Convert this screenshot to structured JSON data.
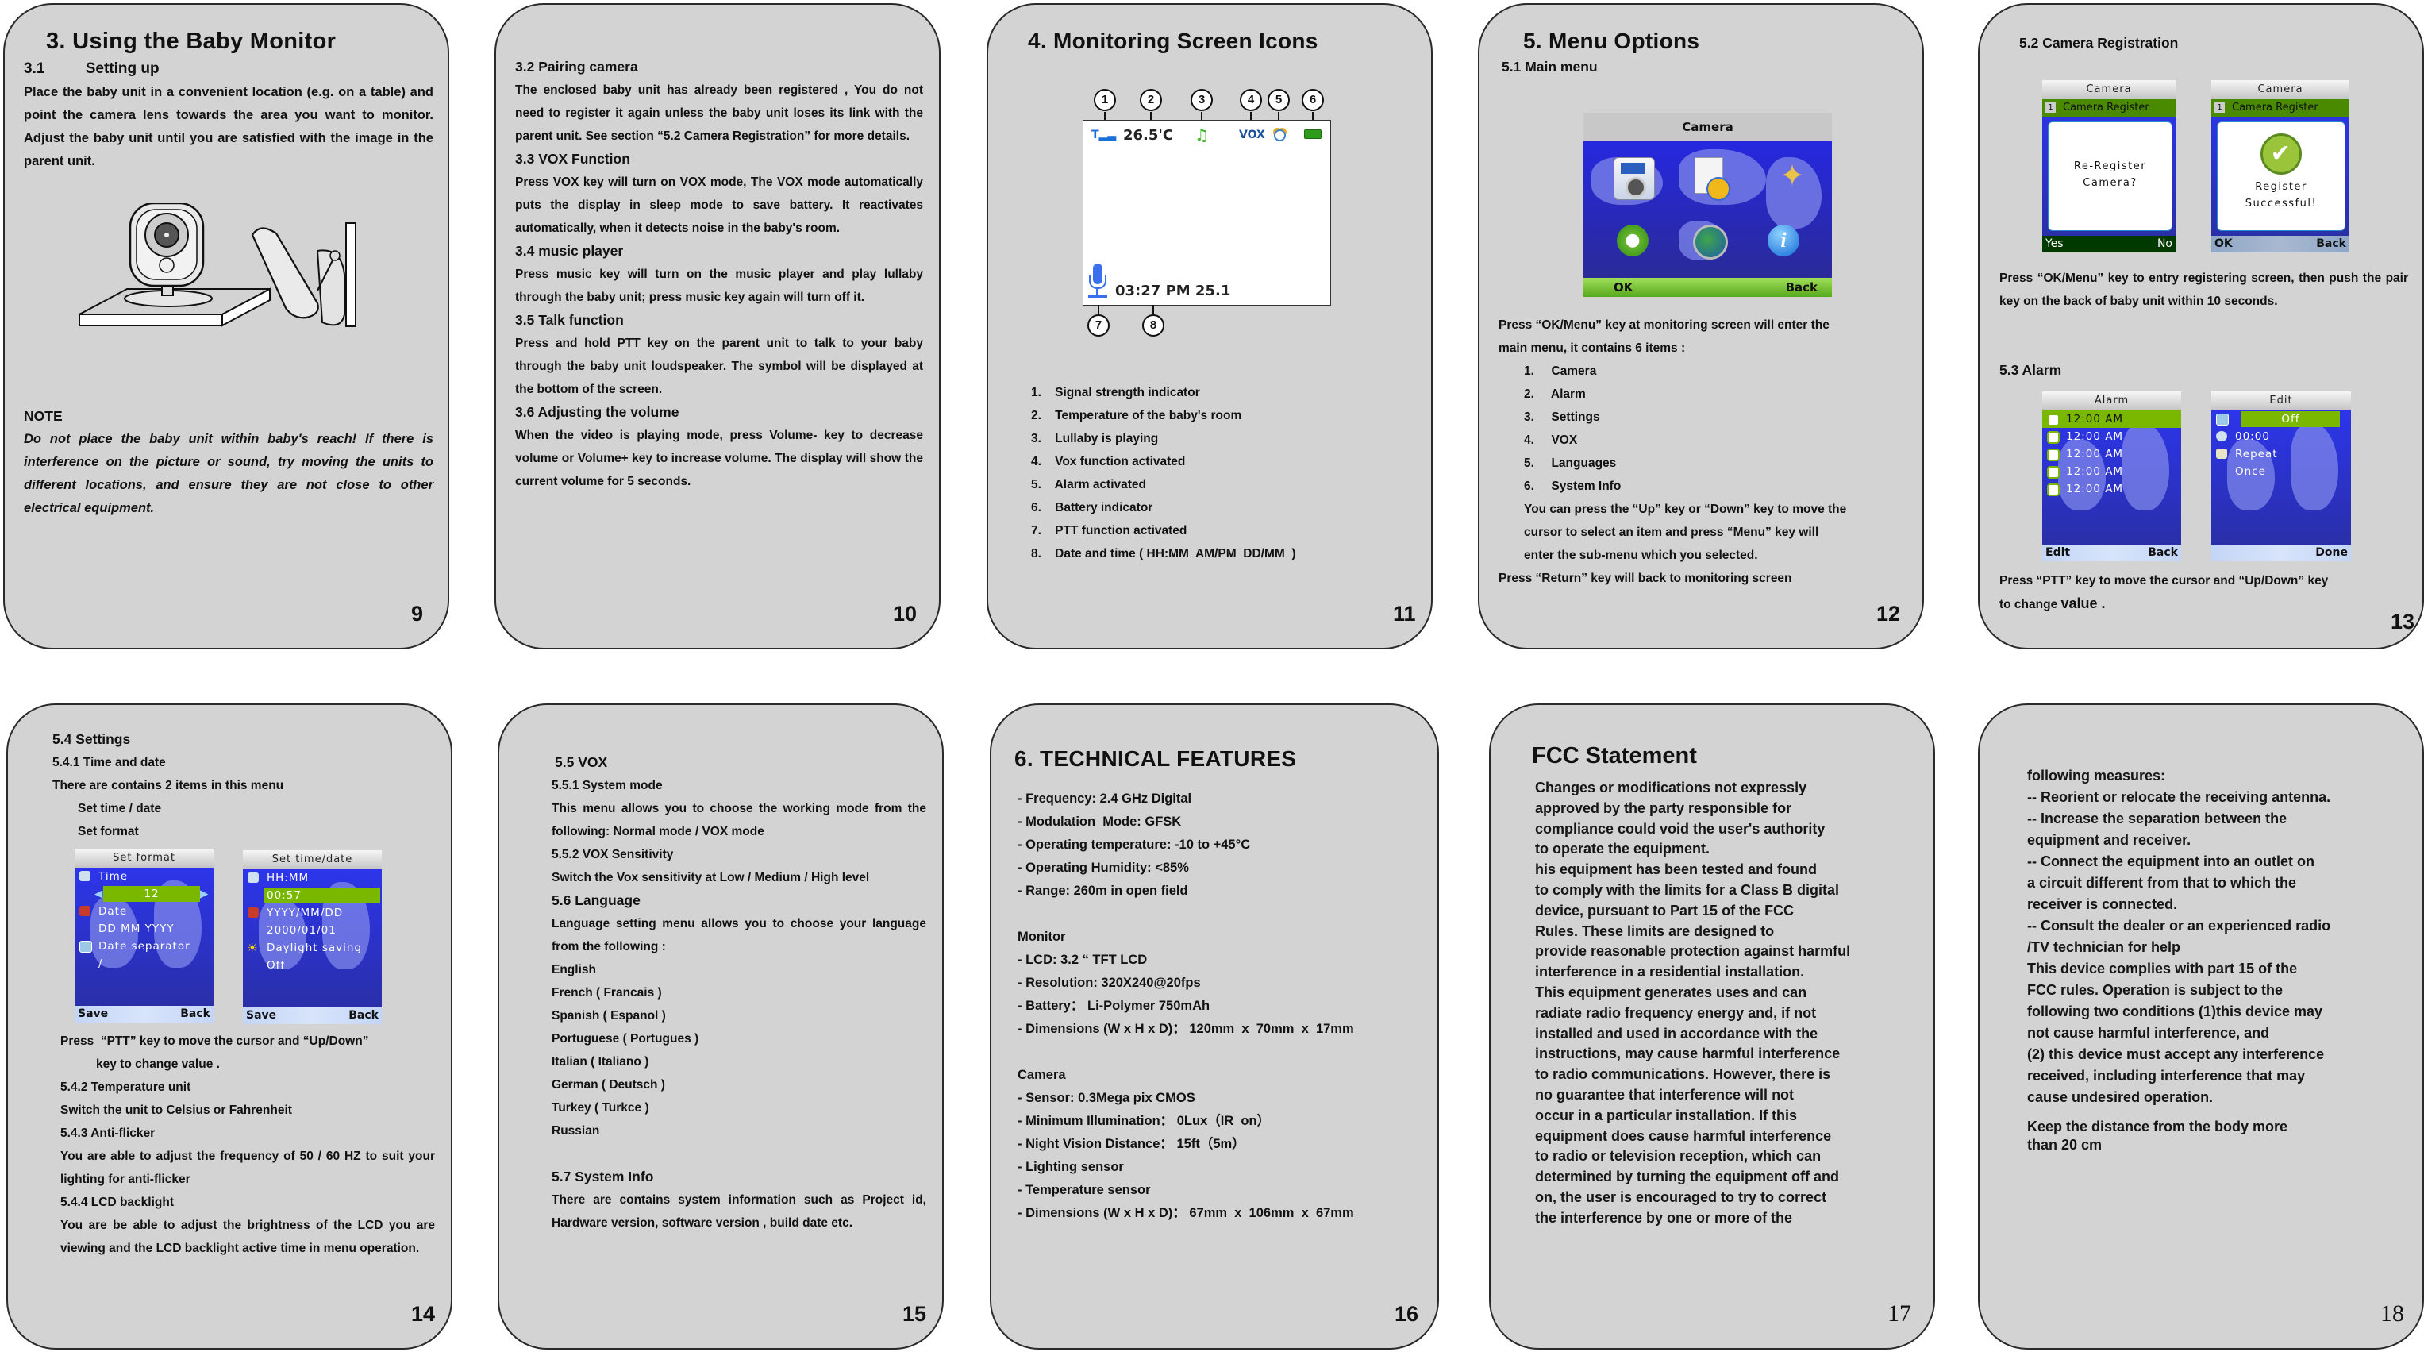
{
  "p9": {
    "title": "3. Using the Baby Monitor",
    "h_num": "3.1",
    "h_text": "Setting up",
    "para": "Place the baby unit in a convenient location (e.g. on a table) and point the camera lens towards the area you want to monitor.  Adjust the baby unit until you are satisfied with the image in the parent unit.",
    "note_label": "NOTE",
    "note": "Do not place the baby unit within baby's reach! If there is interference on the picture or sound, try moving the units to different locations, and ensure they are not close to other electrical equipment.",
    "page": "9"
  },
  "p10": {
    "sections": [
      {
        "h": "3.2 Pairing camera",
        "t": "The enclosed baby unit has already been registered , You do not need to register it again unless the baby unit loses its link with the parent unit. See section “5.2 Camera Registration” for more details."
      },
      {
        "h": "3.3 VOX Function",
        "t": "Press VOX key will turn on VOX mode, The VOX mode automatically puts the display in sleep mode to save battery. It reactivates automatically, when it detects noise in the baby's room."
      },
      {
        "h": "3.4 music player",
        "t": "Press music key will turn on the music player and play lullaby through the baby unit; press music key  again will turn off it."
      },
      {
        "h": "3.5 Talk function",
        "t": "Press and hold PTT key on the parent unit to talk to your baby through the baby unit loudspeaker. The symbol will be displayed at the bottom of the screen."
      },
      {
        "h": "3.6 Adjusting the volume",
        "t": "When the video is playing mode, press  Volume- key to decrease volume or Volume+ key to increase volume. The display will show the current volume for 5 seconds."
      }
    ],
    "page": "10"
  },
  "p11": {
    "title": "4. Monitoring Screen Icons",
    "callouts": [
      "1",
      "2",
      "3",
      "4",
      "5",
      "6",
      "7",
      "8"
    ],
    "screen": {
      "temperature": "26.5'C",
      "vox": "VOX",
      "datetime": "03:27 PM 25.1",
      "icon_colors": {
        "signal": "#1a6fd6",
        "music": "#3cb521",
        "vox": "#1a4f9a",
        "battery": "#2e9a1e",
        "mic": "#3a6ff0"
      }
    },
    "items": [
      "1.    Signal strength indicator",
      "2.    Temperature of the baby's room",
      "3.    Lullaby is playing",
      "4.    Vox function activated",
      "5.    Alarm activated",
      "6.    Battery indicator",
      "7.    PTT function activated",
      "8.    Date and time ( HH:MM  AM/PM  DD/MM  )"
    ],
    "page": "11"
  },
  "p12": {
    "title": "5. Menu Options",
    "subtitle": "5.1 Main menu",
    "screen": {
      "header": "Camera",
      "ok": "OK",
      "back": "Back",
      "icons": [
        "camera-icon",
        "alarm-clock-icon",
        "settings-tools-icon",
        "vox-wireless-icon",
        "language-globe-icon",
        "info-icon"
      ]
    },
    "intro": [
      "Press “OK/Menu” key at monitoring screen will enter the",
      "main menu, it contains 6 items :"
    ],
    "items": [
      "1.     Camera",
      "2.     Alarm",
      "3.     Settings",
      "4.     VOX",
      "5.     Languages",
      "6.     System Info"
    ],
    "nav": [
      "You can press the “Up” key or “Down” key to move the",
      "cursor to select an item and press “Menu” key will",
      "enter the sub-menu which you selected."
    ],
    "return": "Press “Return” key will back to monitoring screen",
    "page": "12"
  },
  "p13": {
    "title": "5.2 Camera Registration",
    "reg1": {
      "header": "Camera",
      "bar_num": "1",
      "bar": "Camera Register",
      "dialog1": "Re-Register",
      "dialog2": "Camera?",
      "left": "Yes",
      "right": "No"
    },
    "reg2": {
      "header": "Camera",
      "bar_num": "1",
      "bar": "Camera Register",
      "dialog1": "Register",
      "dialog2": "Successful!",
      "left": "OK",
      "right": "Back"
    },
    "reg_text": "Press “OK/Menu” key to entry registering screen, then push the pair key on the back of baby unit within 10 seconds.",
    "alarm_title": "5.3 Alarm",
    "alarm": {
      "header": "Alarm",
      "rows": [
        "12:00 AM",
        "12:00 AM",
        "12:00 AM",
        "12:00 AM",
        "12:00 AM"
      ],
      "left": "Edit",
      "right": "Back"
    },
    "edit": {
      "header": "Edit",
      "state": "Off",
      "time": "00:00",
      "repeat": "Repeat",
      "once": "Once",
      "right": "Done"
    },
    "alarm_text_a": "Press “PTT” key to move the cursor and “Up/Down” key",
    "alarm_text_b": "to change ",
    "alarm_text_c": "value .",
    "page": "13"
  },
  "p14": {
    "lines_top": [
      "5.4 Settings",
      "5.4.1 Time and date",
      "There are contains 2 items in this menu",
      "Set time / date",
      "Set format"
    ],
    "fmt": {
      "header": "Set format",
      "time": "Time",
      "time_val": "12",
      "date": "Date",
      "date_val": "DD MM YYYY",
      "sep": "Date separator",
      "sep_val": "/",
      "left": "Save",
      "right": "Back"
    },
    "td": {
      "header": "Set time/date",
      "hhmm": "HH:MM",
      "time_val": "00:57",
      "ymd": "YYYY/MM/DD",
      "date_val": "2000/01/01",
      "dst": "Daylight saving",
      "dst_val": "Off",
      "left": "Save",
      "right": "Back"
    },
    "press_a": "Press  “PTT” key to move the cursor and “Up/Down”",
    "press_b": "key to change value .",
    "sections": [
      {
        "h": "5.4.2 Temperature unit",
        "t": "Switch the unit to Celsius or Fahrenheit"
      },
      {
        "h": "5.4.3 Anti-flicker",
        "t": "You are able to adjust the frequency of 50 / 60 HZ to suit your lighting for anti-flicker"
      },
      {
        "h": "5.4.4 LCD backlight",
        "t": "You are be able to adjust the brightness of the LCD you are viewing and the LCD backlight active time in menu operation."
      }
    ],
    "page": "14"
  },
  "p15": {
    "title": "5.5 VOX",
    "s1_h": "5.5.1 System mode",
    "s1_t": "This menu allows you to choose the working mode from the following:  Normal mode / VOX mode",
    "s2_h": "5.5.2 VOX Sensitivity",
    "s2_t": "Switch the Vox sensitivity at Low / Medium / High level",
    "s3_h": "5.6 Language",
    "s3_t": "Language setting menu allows you to choose your language from the following :",
    "languages": [
      "English",
      "French ( Francais )",
      "Spanish ( Espanol )",
      "Portuguese ( Portugues )",
      "Italian ( Italiano )",
      "German ( Deutsch )",
      "Turkey ( Turkce )",
      "Russian"
    ],
    "s4_h": "5.7 System Info",
    "s4_t": "There are contains system information such as Project  id, Hardware version, software version , build date etc.",
    "page": "15"
  },
  "p16": {
    "title": "6. TECHNICAL FEATURES",
    "general": [
      "- Frequency: 2.4 GHz Digital",
      "- Modulation  Mode: GFSK",
      "- Operating temperature: -10 to +45°C",
      "- Operating Humidity: <85%",
      "- Range: 260m in open field"
    ],
    "monitor_h": "Monitor",
    "monitor": [
      "- LCD: 3.2 “ TFT LCD",
      "- Resolution: 320X240@20fps",
      "- Battery： Li-Polymer 750mAh",
      "- Dimensions (W x H x D)： 120mm  x  70mm  x  17mm"
    ],
    "camera_h": "Camera",
    "camera": [
      "- Sensor: 0.3Mega pix CMOS",
      "- Minimum Illumination： 0Lux（IR  on）",
      "- Night Vision Distance： 15ft（5m）",
      "- Lighting sensor",
      "- Temperature sensor",
      "- Dimensions (W x H x D)： 67mm  x  106mm  x  67mm"
    ],
    "page": "16"
  },
  "p17": {
    "title": "FCC Statement",
    "lines": [
      "Changes or modifications not expressly",
      "approved by the party responsible for",
      "compliance could void the user's authority",
      "to operate the equipment.",
      "his equipment has been tested and found",
      "to comply with the limits for a Class B digital",
      "device, pursuant to Part 15 of the FCC",
      "Rules. These limits are designed to",
      "provide reasonable protection against harmful",
      "interference in a residential installation.",
      "This equipment generates uses and can",
      "radiate radio frequency energy and, if not",
      "installed and used in accordance with the",
      "instructions, may cause harmful interference",
      "to radio communications. However, there is",
      "no guarantee that interference will not",
      "occur in a particular installation. If this",
      "equipment does cause harmful interference",
      "to radio or television reception, which can",
      "determined by turning the equipment off and",
      "on, the user is encouraged to try to correct",
      "the interference by one or more of the"
    ],
    "page": "17"
  },
  "p18": {
    "lines": [
      "following measures:",
      "-- Reorient or relocate the receiving antenna.",
      "-- Increase the separation between the",
      "equipment and receiver.",
      "-- Connect the equipment into an outlet on",
      "a circuit different from that to which the",
      "receiver is connected.",
      "-- Consult the dealer or an experienced radio",
      "/TV technician for help",
      "This device complies with part 15 of the",
      "FCC rules. Operation is subject to the",
      "following two conditions (1)this device may",
      "not cause harmful interference, and",
      "(2) this device must accept any interference",
      "received, including interference that may",
      "cause undesired operation."
    ],
    "keep": [
      "Keep the distance from the body more",
      "than 20 cm"
    ],
    "page": "18"
  },
  "colors": {
    "panel": "#d3d3d3",
    "screen_blue": "#2c36f4",
    "highlight_green": "#7ab800",
    "footer_blue": "#c3d5f7"
  }
}
